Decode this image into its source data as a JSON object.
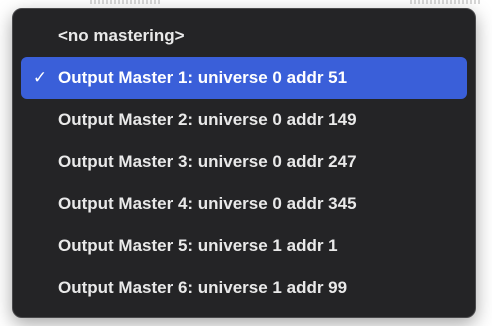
{
  "menu": {
    "items": [
      {
        "label": "<no mastering>",
        "checked": false
      },
      {
        "label": "Output Master 1: universe 0 addr 51",
        "checked": true
      },
      {
        "label": "Output Master 2: universe 0 addr 149",
        "checked": false
      },
      {
        "label": "Output Master 3: universe 0 addr 247",
        "checked": false
      },
      {
        "label": "Output Master 4: universe 0 addr 345",
        "checked": false
      },
      {
        "label": "Output Master 5: universe 1 addr 1",
        "checked": false
      },
      {
        "label": "Output Master 6: universe 1 addr 99",
        "checked": false
      }
    ],
    "check_glyph": "✓",
    "highlight_color": "#3a5fd9",
    "background_color": "#242426"
  }
}
